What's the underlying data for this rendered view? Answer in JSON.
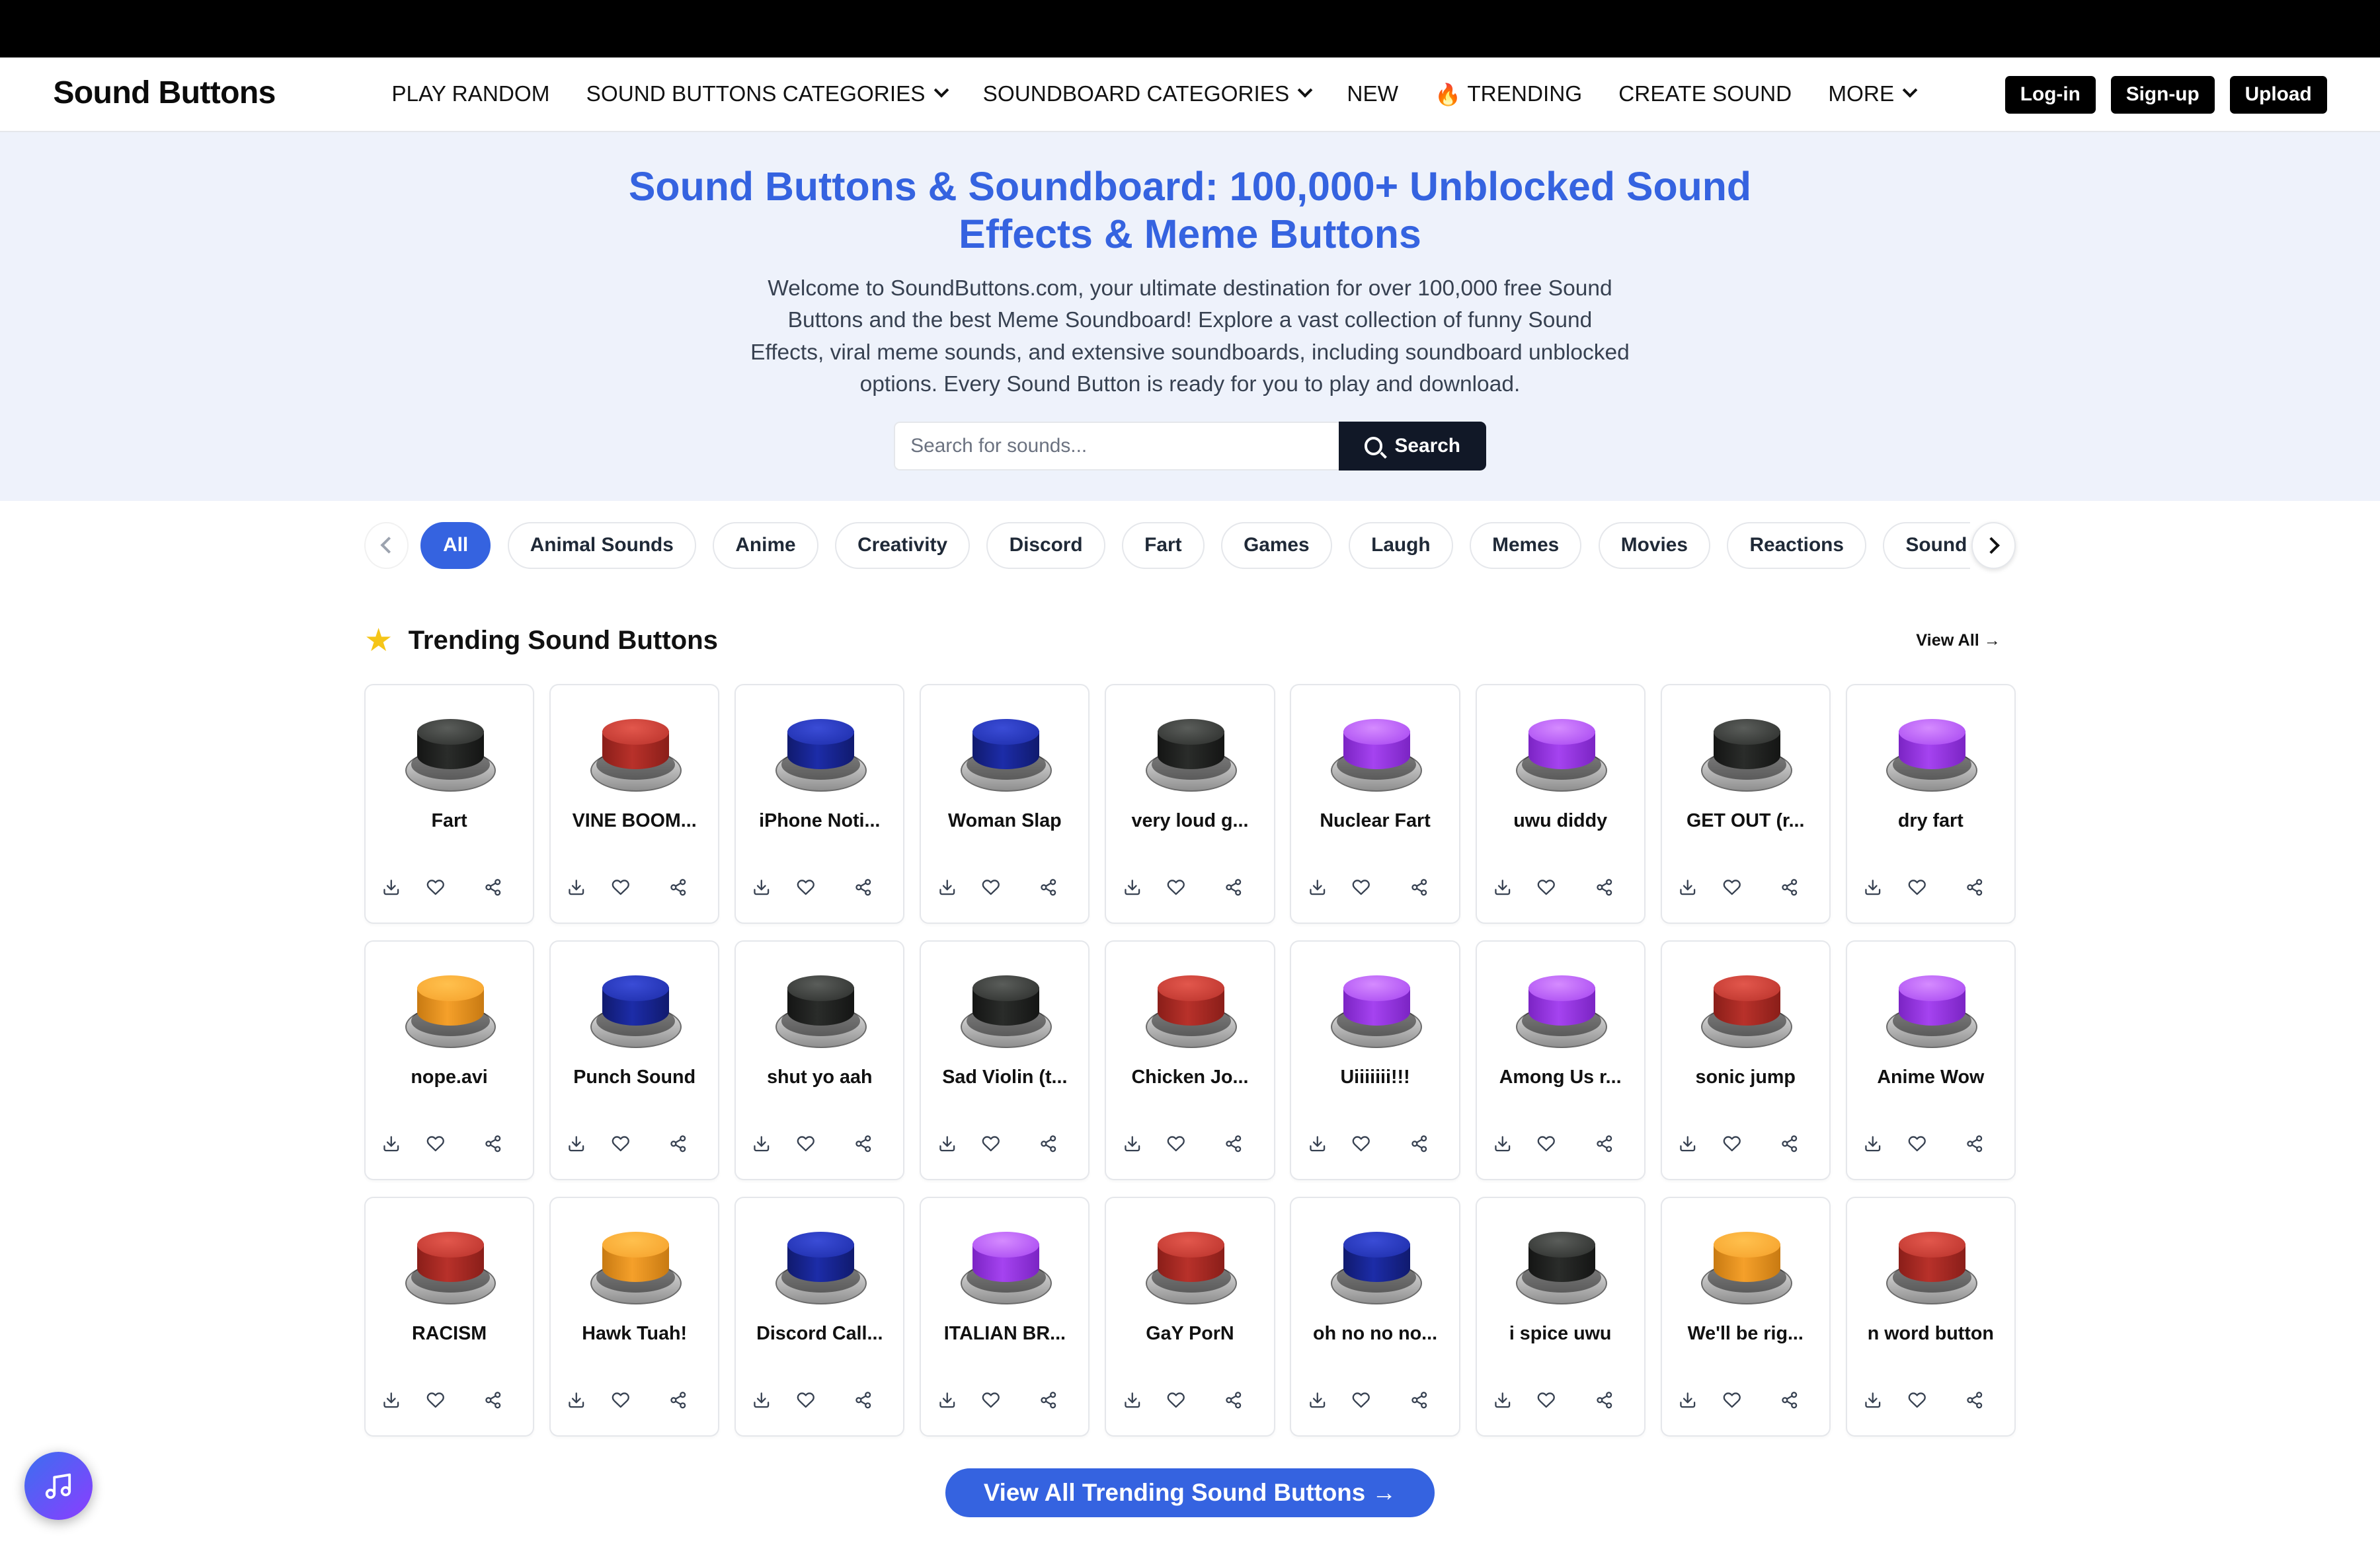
{
  "site": {
    "logo": "Sound Buttons"
  },
  "nav": {
    "items": [
      {
        "label": "PLAY RANDOM",
        "dropdown": false
      },
      {
        "label": "SOUND BUTTONS CATEGORIES",
        "dropdown": true
      },
      {
        "label": "SOUNDBOARD CATEGORIES",
        "dropdown": true
      },
      {
        "label": "NEW",
        "dropdown": false
      },
      {
        "label": "TRENDING",
        "dropdown": false,
        "icon": "fire-icon"
      },
      {
        "label": "CREATE SOUND",
        "dropdown": false
      },
      {
        "label": "MORE",
        "dropdown": true
      }
    ],
    "login": "Log-in",
    "signup": "Sign-up",
    "upload": "Upload"
  },
  "hero": {
    "title": "Sound Buttons & Soundboard: 100,000+ Unblocked Sound Effects & Meme Buttons",
    "description": "Welcome to SoundButtons.com, your ultimate destination for over 100,000 free Sound Buttons and the best Meme Soundboard! Explore a vast collection of funny Sound Effects, viral meme sounds, and extensive soundboards, including soundboard unblocked options. Every Sound Button is ready for you to play and download.",
    "search_placeholder": "Search for sounds...",
    "search_label": "Search"
  },
  "categories": [
    "All",
    "Animal Sounds",
    "Anime",
    "Creativity",
    "Discord",
    "Fart",
    "Games",
    "Laugh",
    "Memes",
    "Movies",
    "Reactions",
    "Sound Effects"
  ],
  "active_category": "All",
  "trending": {
    "title": "Trending Sound Buttons",
    "view_all": "View All →",
    "view_all_button": "View All Trending Sound Buttons →"
  },
  "colors": {
    "black": [
      "#5a5d5a",
      "#2a2c2a",
      "#141514"
    ],
    "red": [
      "#e2574c",
      "#b8312a",
      "#8a1e19"
    ],
    "blue": [
      "#3a4cd6",
      "#1c2ca8",
      "#101a6e"
    ],
    "purple": [
      "#d58bff",
      "#a543f0",
      "#7b24c4"
    ],
    "orange": [
      "#ffc04d",
      "#f5a02a",
      "#c87a12"
    ],
    "accent": "#3563e0"
  },
  "sounds": [
    {
      "name": "Fart",
      "color": "black"
    },
    {
      "name": "VINE BOOM...",
      "color": "red"
    },
    {
      "name": "iPhone Noti...",
      "color": "blue"
    },
    {
      "name": "Woman Slap",
      "color": "blue"
    },
    {
      "name": "very loud g...",
      "color": "black"
    },
    {
      "name": "Nuclear Fart",
      "color": "purple"
    },
    {
      "name": "uwu diddy",
      "color": "purple"
    },
    {
      "name": "GET OUT (r...",
      "color": "black"
    },
    {
      "name": "dry fart",
      "color": "purple"
    },
    {
      "name": "nope.avi",
      "color": "orange"
    },
    {
      "name": "Punch Sound",
      "color": "blue"
    },
    {
      "name": "shut yo aah",
      "color": "black"
    },
    {
      "name": "Sad Violin (t...",
      "color": "black"
    },
    {
      "name": "Chicken Jo...",
      "color": "red"
    },
    {
      "name": "Uiiiiiii!!!",
      "color": "purple"
    },
    {
      "name": "Among Us r...",
      "color": "purple"
    },
    {
      "name": "sonic jump",
      "color": "red"
    },
    {
      "name": "Anime Wow",
      "color": "purple"
    },
    {
      "name": "RACISM",
      "color": "red"
    },
    {
      "name": "Hawk Tuah!",
      "color": "orange"
    },
    {
      "name": "Discord Call...",
      "color": "blue"
    },
    {
      "name": "ITALIAN BR...",
      "color": "purple"
    },
    {
      "name": "GaY PorN",
      "color": "red"
    },
    {
      "name": "oh no no no...",
      "color": "blue"
    },
    {
      "name": "i spice uwu",
      "color": "black"
    },
    {
      "name": "We'll be rig...",
      "color": "orange"
    },
    {
      "name": "n word button",
      "color": "red"
    }
  ]
}
